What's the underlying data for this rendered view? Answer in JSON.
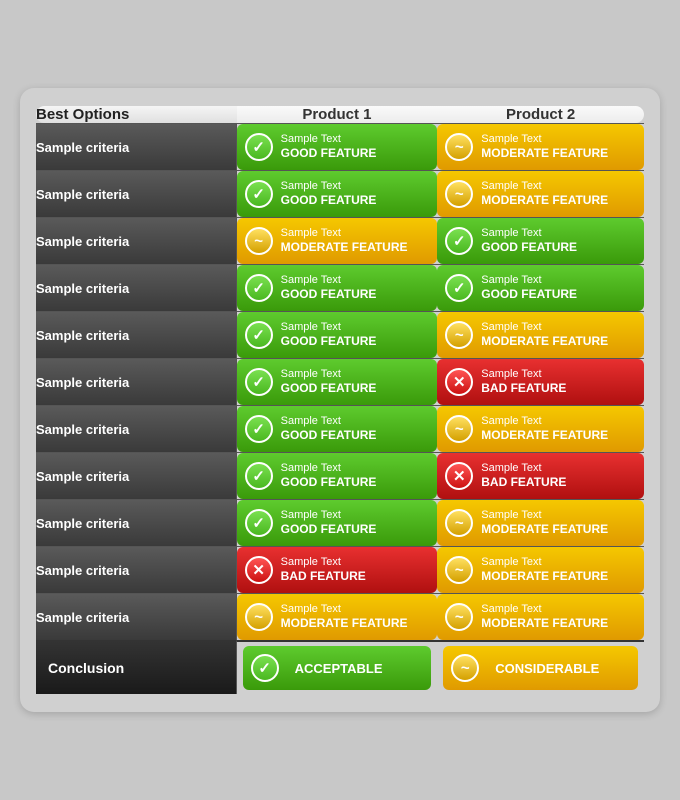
{
  "header": {
    "col1": "Best Options",
    "col2": "Product 1",
    "col3": "Product 2"
  },
  "rows": [
    {
      "criteria": "Sample criteria",
      "p1": {
        "type": "good",
        "sample": "Sample Text",
        "label": "GOOD FEATURE"
      },
      "p2": {
        "type": "moderate",
        "sample": "Sample Text",
        "label": "MODERATE FEATURE"
      }
    },
    {
      "criteria": "Sample criteria",
      "p1": {
        "type": "good",
        "sample": "Sample Text",
        "label": "GOOD FEATURE"
      },
      "p2": {
        "type": "moderate",
        "sample": "Sample Text",
        "label": "MODERATE FEATURE"
      }
    },
    {
      "criteria": "Sample criteria",
      "p1": {
        "type": "moderate",
        "sample": "Sample Text",
        "label": "MODERATE FEATURE"
      },
      "p2": {
        "type": "good",
        "sample": "Sample Text",
        "label": "GOOD FEATURE"
      }
    },
    {
      "criteria": "Sample criteria",
      "p1": {
        "type": "good",
        "sample": "Sample Text",
        "label": "GOOD FEATURE"
      },
      "p2": {
        "type": "good",
        "sample": "Sample Text",
        "label": "GOOD FEATURE"
      }
    },
    {
      "criteria": "Sample criteria",
      "p1": {
        "type": "good",
        "sample": "Sample Text",
        "label": "GOOD FEATURE"
      },
      "p2": {
        "type": "moderate",
        "sample": "Sample Text",
        "label": "MODERATE FEATURE"
      }
    },
    {
      "criteria": "Sample criteria",
      "p1": {
        "type": "good",
        "sample": "Sample Text",
        "label": "GOOD FEATURE"
      },
      "p2": {
        "type": "bad",
        "sample": "Sample Text",
        "label": "BAD FEATURE"
      }
    },
    {
      "criteria": "Sample criteria",
      "p1": {
        "type": "good",
        "sample": "Sample Text",
        "label": "GOOD FEATURE"
      },
      "p2": {
        "type": "moderate",
        "sample": "Sample Text",
        "label": "MODERATE FEATURE"
      }
    },
    {
      "criteria": "Sample criteria",
      "p1": {
        "type": "good",
        "sample": "Sample Text",
        "label": "GOOD FEATURE"
      },
      "p2": {
        "type": "bad",
        "sample": "Sample Text",
        "label": "BAD FEATURE"
      }
    },
    {
      "criteria": "Sample criteria",
      "p1": {
        "type": "good",
        "sample": "Sample Text",
        "label": "GOOD FEATURE"
      },
      "p2": {
        "type": "moderate",
        "sample": "Sample Text",
        "label": "MODERATE FEATURE"
      }
    },
    {
      "criteria": "Sample criteria",
      "p1": {
        "type": "bad",
        "sample": "Sample Text",
        "label": "BAD FEATURE"
      },
      "p2": {
        "type": "moderate",
        "sample": "Sample Text",
        "label": "MODERATE FEATURE"
      }
    },
    {
      "criteria": "Sample criteria",
      "p1": {
        "type": "moderate",
        "sample": "Sample Text",
        "label": "MODERATE FEATURE"
      },
      "p2": {
        "type": "moderate",
        "sample": "Sample Text",
        "label": "MODERATE FEATURE"
      }
    }
  ],
  "conclusion": {
    "label": "Conclusion",
    "p1": {
      "type": "good",
      "label": "ACCEPTABLE"
    },
    "p2": {
      "type": "moderate",
      "label": "CONSIDERABLE"
    }
  },
  "icons": {
    "good": "✓",
    "moderate": "~",
    "bad": "✕"
  }
}
